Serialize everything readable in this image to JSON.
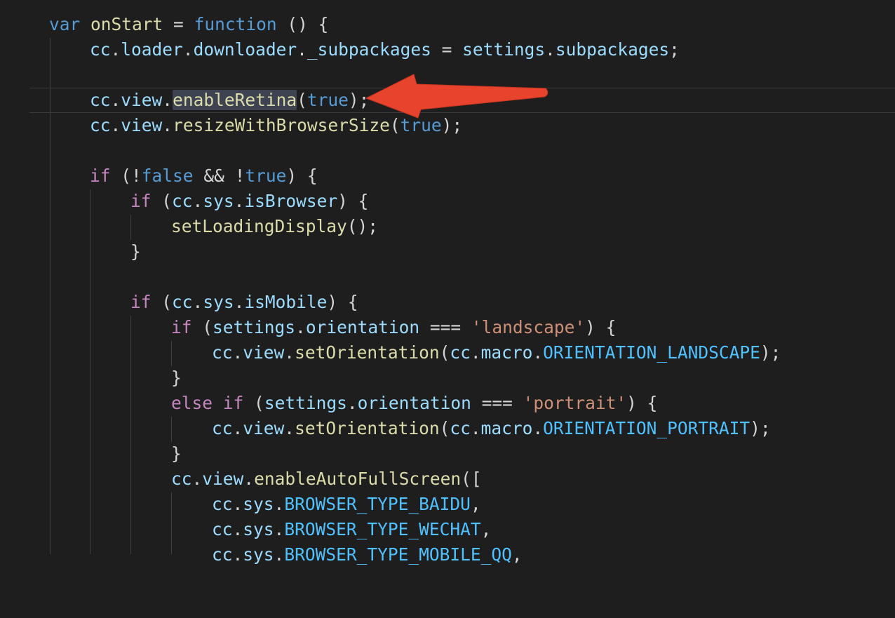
{
  "code": {
    "l1": {
      "kw": "var",
      "name": "onStart",
      "eq": " = ",
      "fn": "function",
      "rest": " () {"
    },
    "l2": {
      "a": "cc",
      "b": "loader",
      "c": "downloader",
      "d": "_subpackages",
      "e": "settings",
      "f": "subpackages"
    },
    "l3": {
      "a": "cc",
      "b": "view",
      "fn": "enableRetina",
      "arg": "true"
    },
    "l4": {
      "a": "cc",
      "b": "view",
      "fn": "resizeWithBrowserSize",
      "arg": "true"
    },
    "l5": {
      "kw": "if",
      "p1": " (",
      "not1": "!",
      "f": "false",
      "and": " && ",
      "not2": "!",
      "t": "true",
      "end": ") {"
    },
    "l6": {
      "kw": "if",
      "a": "cc",
      "b": "sys",
      "c": "isBrowser",
      "end": ") {"
    },
    "l7": {
      "fn": "setLoadingDisplay",
      "end": "();"
    },
    "l8": {
      "brace": "}"
    },
    "l9": {
      "kw": "if",
      "a": "cc",
      "b": "sys",
      "c": "isMobile",
      "end": ") {"
    },
    "l10": {
      "kw": "if",
      "a": "settings",
      "b": "orientation",
      "op": " === ",
      "str": "'landscape'",
      "end": ") {"
    },
    "l11": {
      "a": "cc",
      "b": "view",
      "fn": "setOrientation",
      "c": "cc",
      "d": "macro",
      "e": "ORIENTATION_LANDSCAPE",
      "end": ");"
    },
    "l12": {
      "brace": "}"
    },
    "l13": {
      "kw1": "else",
      "kw2": "if",
      "a": "settings",
      "b": "orientation",
      "op": " === ",
      "str": "'portrait'",
      "end": ") {"
    },
    "l14": {
      "a": "cc",
      "b": "view",
      "fn": "setOrientation",
      "c": "cc",
      "d": "macro",
      "e": "ORIENTATION_PORTRAIT",
      "end": ");"
    },
    "l15": {
      "brace": "}"
    },
    "l16": {
      "a": "cc",
      "b": "view",
      "fn": "enableAutoFullScreen",
      "end": "(["
    },
    "l17": {
      "a": "cc",
      "b": "sys",
      "c": "BROWSER_TYPE_BAIDU",
      "end": ","
    },
    "l18": {
      "a": "cc",
      "b": "sys",
      "c": "BROWSER_TYPE_WECHAT",
      "end": ","
    },
    "l19": {
      "a": "cc",
      "b": "sys",
      "c": "BROWSER_TYPE_MOBILE_QQ",
      "end": ","
    }
  },
  "colors": {
    "background": "#1e1e1e",
    "arrow": "#e8432c",
    "highlight": "#3d4350"
  }
}
